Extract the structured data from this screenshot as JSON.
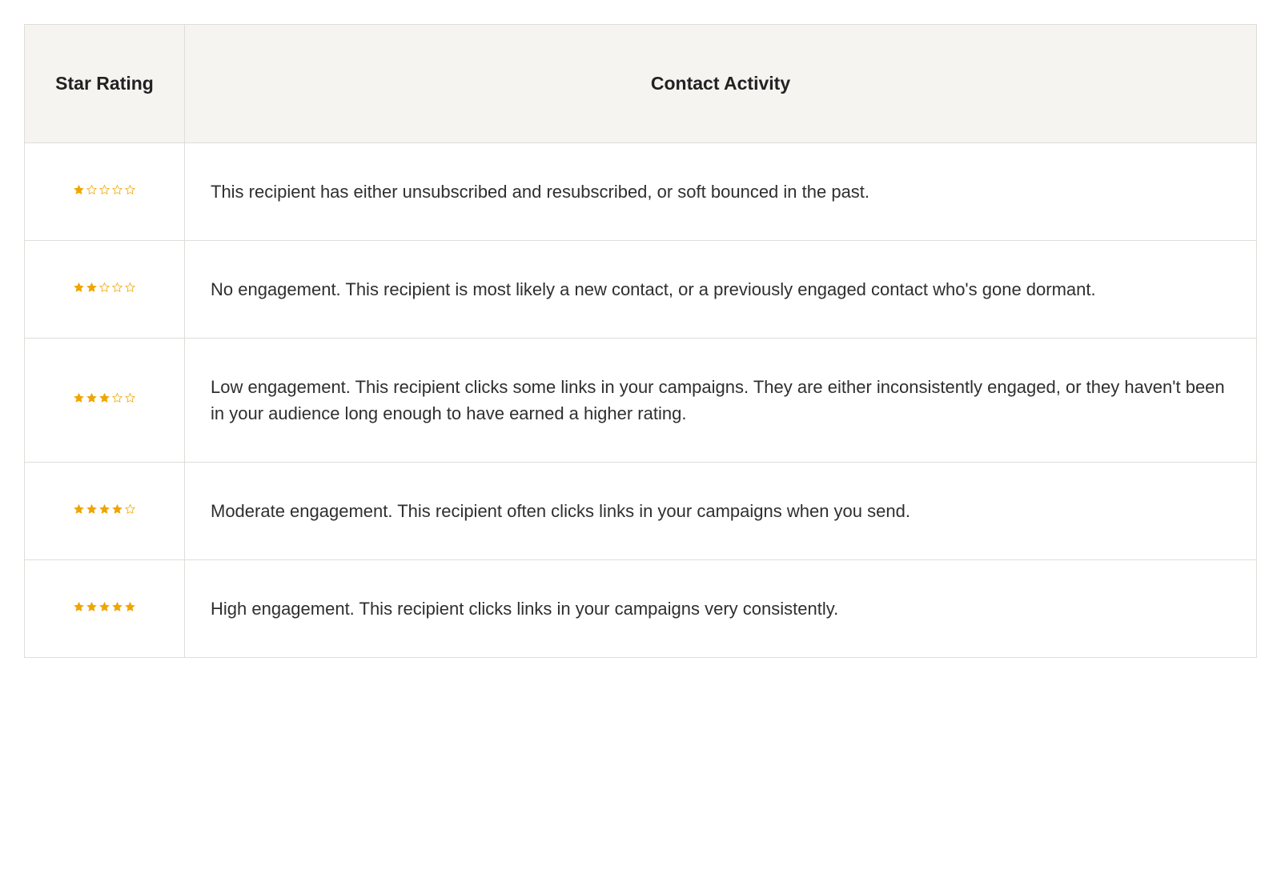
{
  "table": {
    "headers": {
      "star_rating": "Star Rating",
      "contact_activity": "Contact Activity"
    },
    "rows": [
      {
        "stars_filled": 1,
        "stars_total": 5,
        "description": "This recipient has either unsubscribed and resubscribed, or soft bounced in the past."
      },
      {
        "stars_filled": 2,
        "stars_total": 5,
        "description": "No engagement. This recipient is most likely a new contact, or a previously engaged contact who's gone dormant."
      },
      {
        "stars_filled": 3,
        "stars_total": 5,
        "description": "Low engagement. This recipient clicks some links in your campaigns. They are either inconsistently engaged, or they haven't been in your audience long enough to have earned a higher rating."
      },
      {
        "stars_filled": 4,
        "stars_total": 5,
        "description": "Moderate engagement. This recipient often clicks links in your campaigns when you send."
      },
      {
        "stars_filled": 5,
        "stars_total": 5,
        "description": "High engagement. This recipient clicks links in your campaigns very consistently."
      }
    ]
  },
  "colors": {
    "star": "#f0a500",
    "border": "#e0ddd8",
    "header_bg": "#f6f4f0",
    "text": "#2f2f2f"
  }
}
